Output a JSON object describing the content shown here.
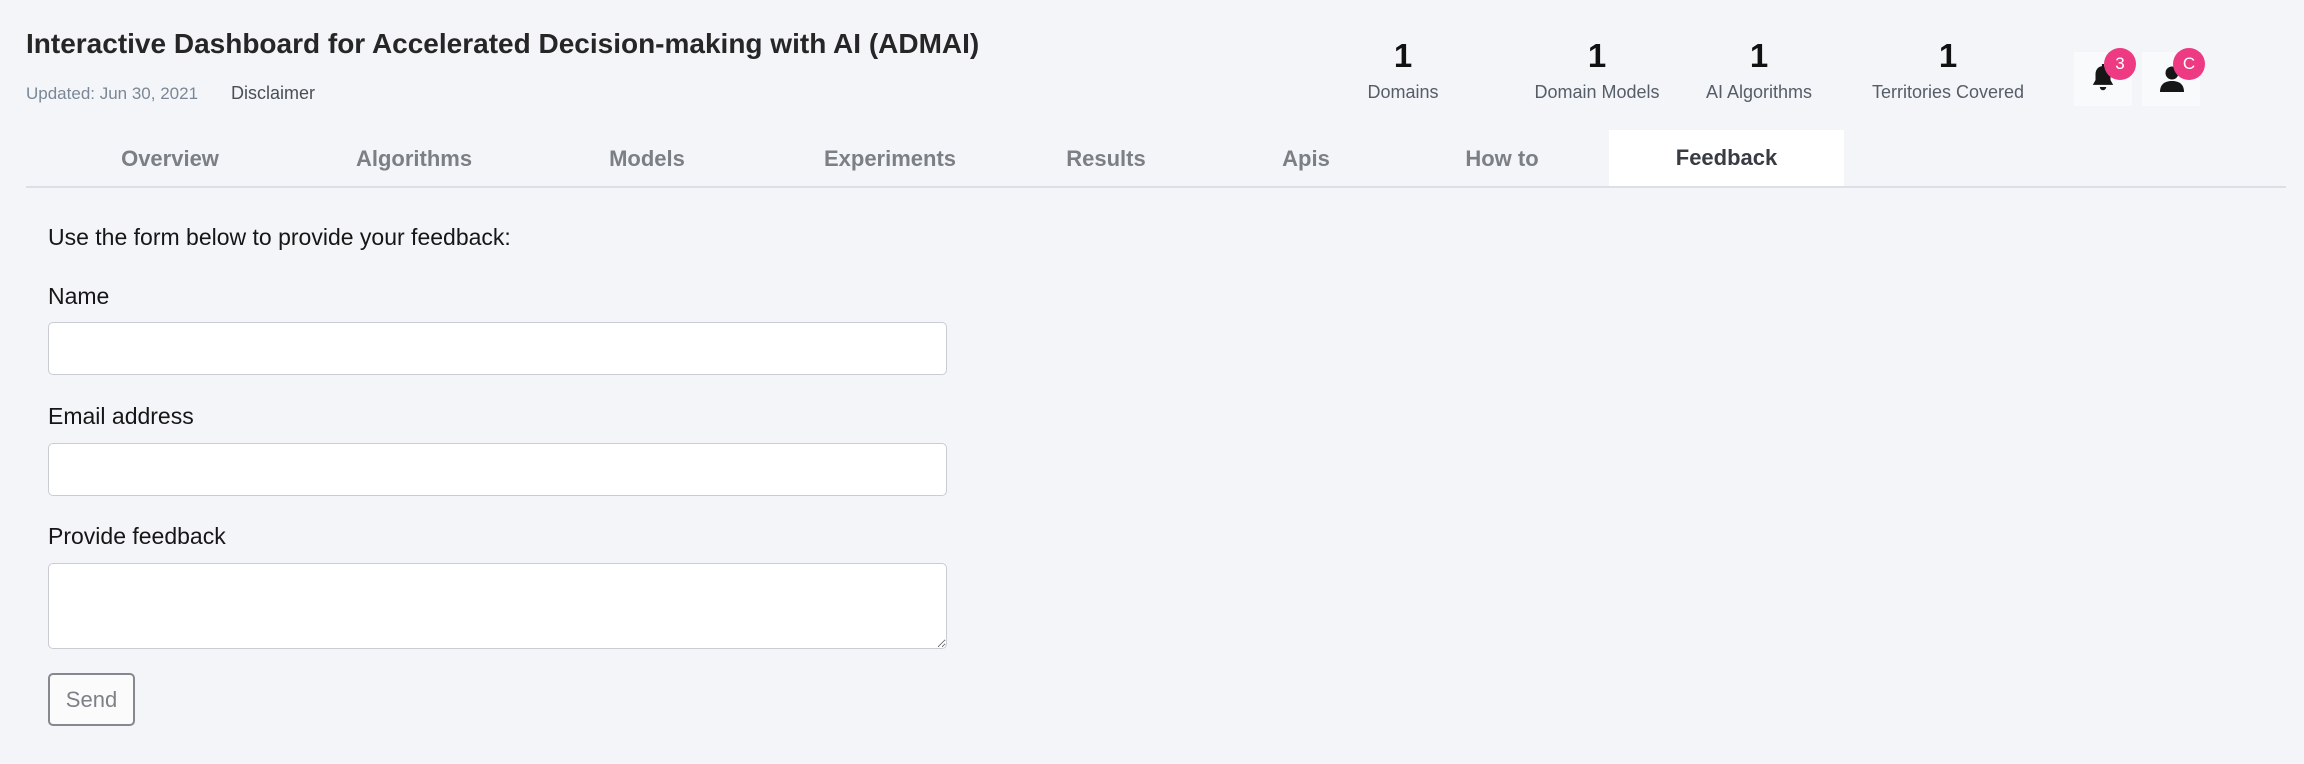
{
  "header": {
    "title": "Interactive Dashboard for Accelerated Decision-making with AI (ADMAI)",
    "updated": "Updated: Jun 30, 2021",
    "disclaimer": "Disclaimer"
  },
  "stats": [
    {
      "value": "1",
      "label": "Domains"
    },
    {
      "value": "1",
      "label": "Domain Models"
    },
    {
      "value": "1",
      "label": "AI Algorithms"
    },
    {
      "value": "1",
      "label": "Territories Covered"
    }
  ],
  "notifications": {
    "icon": "bell-icon",
    "count": "3"
  },
  "user": {
    "icon": "user-icon",
    "initial": "C"
  },
  "tabs": [
    {
      "label": "Overview"
    },
    {
      "label": "Algorithms"
    },
    {
      "label": "Models"
    },
    {
      "label": "Experiments"
    },
    {
      "label": "Results"
    },
    {
      "label": "Apis"
    },
    {
      "label": "How to"
    },
    {
      "label": "Feedback",
      "active": true
    }
  ],
  "form": {
    "intro": "Use the form below to provide your feedback:",
    "name_label": "Name",
    "name_value": "",
    "email_label": "Email address",
    "email_value": "",
    "feedback_label": "Provide feedback",
    "feedback_value": "",
    "send_label": "Send"
  },
  "colors": {
    "background": "#f4f5f9",
    "badge": "#ee3a83",
    "active_tab": "#ffffff",
    "tab_text": "#7b7f86"
  }
}
